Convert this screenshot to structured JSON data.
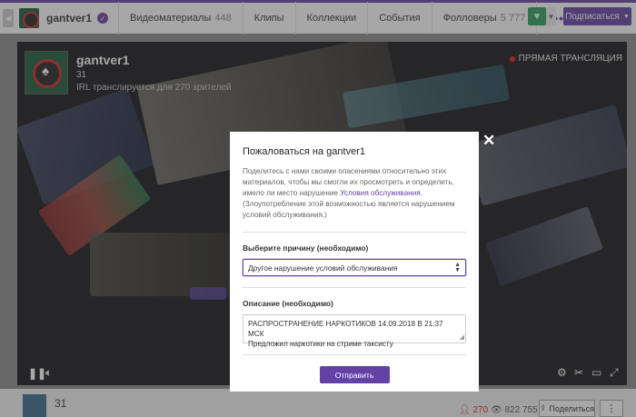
{
  "nav": {
    "channel_name": "gantver1",
    "tabs": [
      {
        "label": "Видеоматериалы",
        "count": "448"
      },
      {
        "label": "Клипы",
        "count": ""
      },
      {
        "label": "Коллекции",
        "count": ""
      },
      {
        "label": "События",
        "count": ""
      },
      {
        "label": "Фолловеры",
        "count": "5 777"
      }
    ],
    "more": "•••",
    "subscribe_label": "Подписаться"
  },
  "player": {
    "channel_name": "gantver1",
    "count": "31",
    "description": "IRL транслируется для 270 зрителей",
    "live_label": "ПРЯМАЯ ТРАНСЛЯЦИЯ"
  },
  "bottom": {
    "number": "31",
    "viewers": "270",
    "views": "822 755",
    "share_label": "Поделиться"
  },
  "modal": {
    "title": "Пожаловаться на gantver1",
    "intro_text": "Поделитесь с нами своими опасениями относительно этих материалов, чтобы мы смогли их просмотреть и определить, имело ли место нарушение ",
    "tos_link": "Условия обслуживания",
    "intro_end": ".",
    "abuse_note": "(Злоупотребление этой возможностью является нарушением условий обслуживания.)",
    "reason_label": "Выберите причину (необходимо)",
    "reason_value": "Другое нарушение условий обслуживания",
    "description_label": "Описание (необходимо)",
    "description_line1": "РАСПРОСТРАНЕНИЕ НАРКОТИКОВ  14.09.2018 В 21:37 МСК",
    "description_line2": "Предложил наркотики на стриме таксисту",
    "submit_label": "Отправить",
    "close": "✕"
  },
  "colors": {
    "accent": "#6441a4",
    "live": "#e91916",
    "follow": "#2a9d5c"
  }
}
